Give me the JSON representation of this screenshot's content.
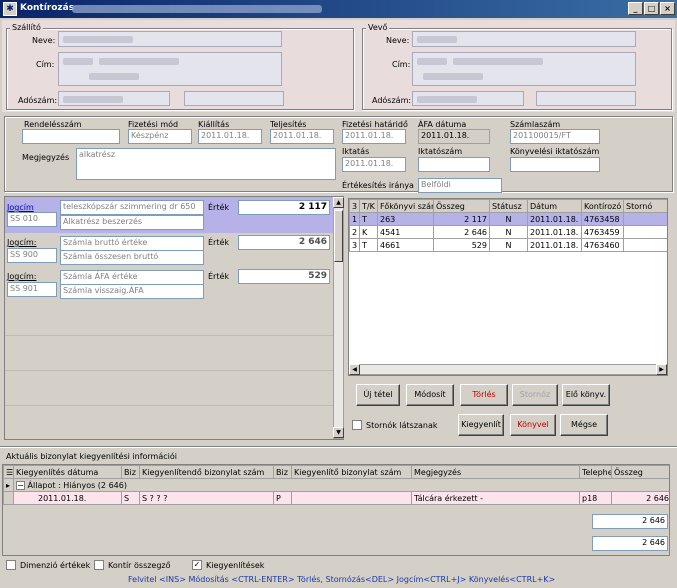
{
  "window": {
    "title": "Kontírozás",
    "controls": [
      "_",
      "□",
      "×"
    ]
  },
  "seller": {
    "group_title": "Szállító",
    "name_label": "Neve:",
    "address_label": "Cím:",
    "tax_label": "Adószám:"
  },
  "buyer": {
    "group_title": "Vevő",
    "name_label": "Neve:",
    "address_label": "Cím:",
    "tax_label": "Adószám:"
  },
  "invoice": {
    "order_no_label": "Rendelésszám",
    "order_no": "",
    "payment_label": "Fizetési mód",
    "payment": "Készpénz",
    "issue_label": "Kiállítás",
    "issue": "2011.01.18.",
    "fulfil_label": "Teljesítés",
    "fulfil": "2011.01.18.",
    "due_label": "Fizetési határidő",
    "due": "2011.01.18.",
    "vat_date_label": "ÁFA dátuma",
    "vat_date": "2011.01.18.",
    "invoice_no_label": "Számlaszám",
    "invoice_no": "201100015/FT",
    "note_label": "Megjegyzés",
    "note": "alkatrész",
    "filing_label": "Iktatás",
    "filing": "2011.01.18.",
    "filing_no_label": "Iktatószám",
    "filing_no": "",
    "book_filing_label": "Könyvelési iktatószám",
    "book_filing": "",
    "sales_dir_label": "Értékesítés iránya",
    "sales_dir": "Belföldi"
  },
  "entries": [
    {
      "jogcim_label": "Jogcím",
      "code": "SS 010",
      "desc1": "teleszkópszár szimmering dr 650",
      "desc2": "Alkatrész beszerzés",
      "value_label": "Érték",
      "value": "2 117",
      "selected": true
    },
    {
      "jogcim_label": "Jogcím:",
      "code": "SS 900",
      "desc1": "Számla bruttó értéke",
      "desc2": "Számla összesen bruttó",
      "value_label": "Érték",
      "value": "2 646",
      "selected": false
    },
    {
      "jogcim_label": "Jogcím:",
      "code": "SS 901",
      "desc1": "Számla ÁFA értéke",
      "desc2": "Számla visszaig.ÁFA",
      "value_label": "Érték",
      "value": "529",
      "selected": false
    }
  ],
  "ledger": {
    "headers": [
      "3",
      "T/K",
      "Főkönyvi szám",
      "Összeg",
      "Státusz",
      "Dátum",
      "Kontírozó",
      "Stornó"
    ],
    "rows": [
      {
        "n": "1",
        "tk": "T",
        "account": "263",
        "amount": "2 117",
        "status": "N",
        "date": "2011.01.18.",
        "kontir": "4763458",
        "storno": ""
      },
      {
        "n": "2",
        "tk": "K",
        "account": "4541",
        "amount": "2 646",
        "status": "N",
        "date": "2011.01.18.",
        "kontir": "4763459",
        "storno": ""
      },
      {
        "n": "3",
        "tk": "T",
        "account": "4661",
        "amount": "529",
        "status": "N",
        "date": "2011.01.18.",
        "kontir": "4763460",
        "storno": ""
      }
    ]
  },
  "buttons": {
    "new": "Új tétel",
    "modify": "Módosít",
    "delete": "Törlés",
    "storno": "Stornóz",
    "prev_book": "Elő könyv.",
    "settle": "Kiegyenlít",
    "book": "Könyvel",
    "cancel": "Mégse"
  },
  "show_storno_label": "Stornók látszanak",
  "settlement": {
    "title": "Aktuális bizonylat kiegyenlítési információi",
    "headers": [
      "Kiegyenlítés dátuma",
      "Biz",
      "Kiegyenlítendő bizonylat szám",
      "Biz",
      "Kiegyenlítő bizonylat szám",
      "Megjegyzés",
      "Telephe",
      "Összeg"
    ],
    "group_row": "Állapot : Hiányos (2 646)",
    "row": {
      "date": "2011.01.18.",
      "biz1": "S",
      "doc": "S ? ? ?",
      "biz2": "P",
      "doc2": "",
      "note": "Tálcára érkezett -",
      "site": "p18",
      "amount": "2 646"
    },
    "subtotal": "2 646",
    "total": "2 646"
  },
  "options": {
    "dimension": "Dimenzió értékek",
    "kontir_sum": "Kontír összegző",
    "settlements": "Kiegyenlítések",
    "settlements_checked": true
  },
  "hotkeys": "Felvitel <INS> Módosítás <CTRL-ENTER> Törlés, Stornózás<DEL> Jogcím<CTRL+J> Könyvelés<CTRL+K>"
}
